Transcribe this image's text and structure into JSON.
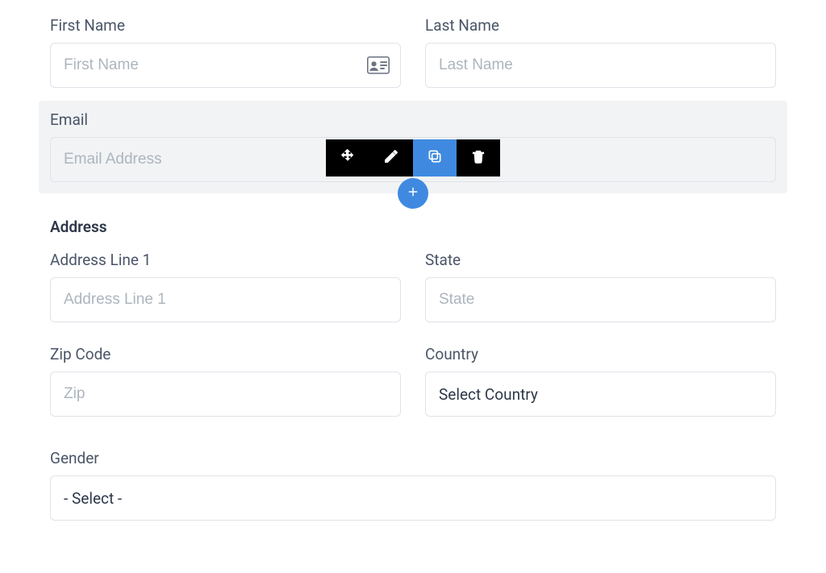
{
  "fields": {
    "first_name": {
      "label": "First Name",
      "placeholder": "First Name"
    },
    "last_name": {
      "label": "Last Name",
      "placeholder": "Last Name"
    },
    "email": {
      "label": "Email",
      "placeholder": "Email Address"
    },
    "address_section_title": "Address",
    "address1": {
      "label": "Address Line 1",
      "placeholder": "Address Line 1"
    },
    "state": {
      "label": "State",
      "placeholder": "State"
    },
    "zip": {
      "label": "Zip Code",
      "placeholder": "Zip"
    },
    "country": {
      "label": "Country",
      "selected": "Select Country"
    },
    "gender": {
      "label": "Gender",
      "selected": "- Select -"
    }
  },
  "toolbar": {
    "move": "move",
    "edit": "edit",
    "copy": "copy",
    "delete": "delete",
    "add": "add"
  }
}
